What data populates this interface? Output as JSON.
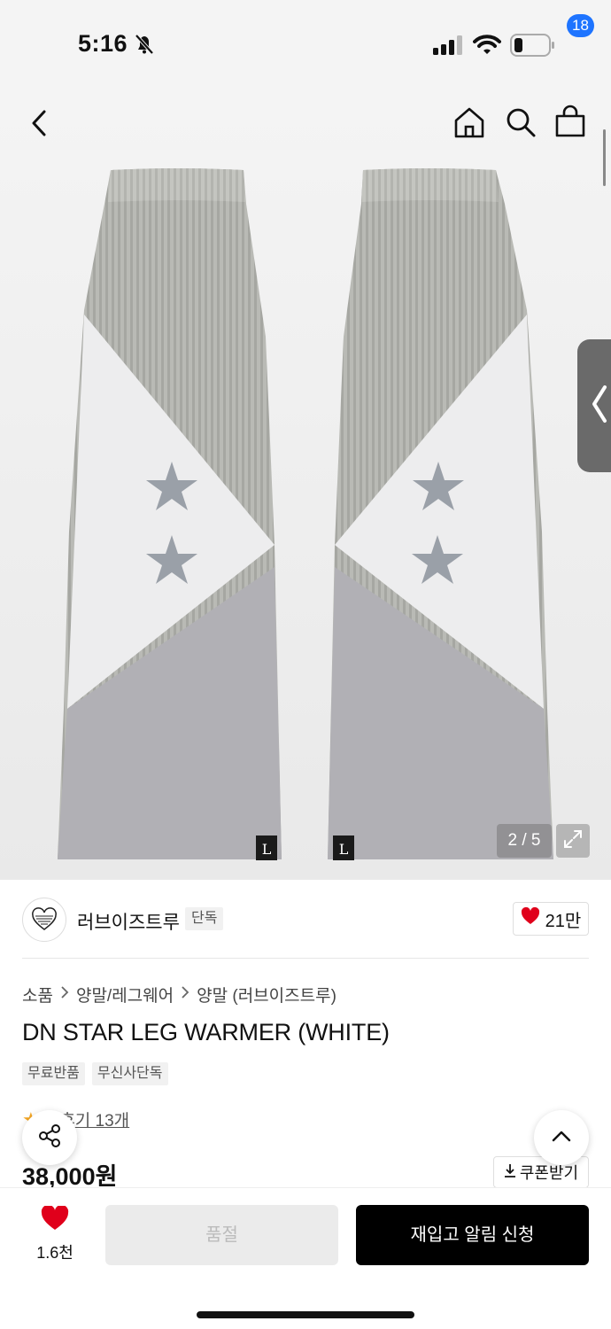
{
  "status_bar": {
    "time": "5:16"
  },
  "header": {
    "cart_count": "18"
  },
  "gallery": {
    "counter": "2 / 5",
    "tag_letter": "L"
  },
  "brand": {
    "name": "러브이즈트루",
    "tag": "단독",
    "likes": "21만"
  },
  "breadcrumb": [
    "소품",
    "양말/레그웨어",
    "양말 (러브이즈트루)"
  ],
  "product": {
    "title": "DN STAR LEG WARMER (WHITE)",
    "chips": [
      "무료반품",
      "무신사단독"
    ],
    "rating_partial": "3",
    "reviews": "후기 13개",
    "price": "38,000원",
    "coupon": "쿠폰받기"
  },
  "bottom_bar": {
    "wish_count": "1.6천",
    "soldout_label": "품절",
    "restock_label": "재입고 알림 신청"
  },
  "colors": {
    "accent": "#1e74ff",
    "heart": "#e0001b",
    "primary_button": "#000000"
  }
}
